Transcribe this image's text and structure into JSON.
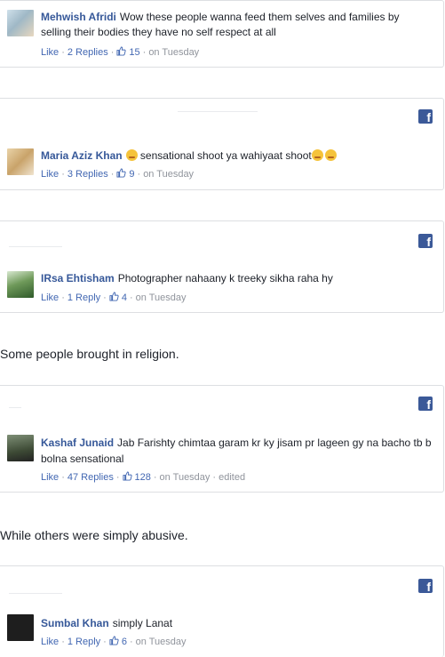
{
  "comments": [
    {
      "author": "Mehwish Afridi",
      "text": "Wow these people wanna feed them selves and families by selling their bodies they have no self respect at all",
      "like_label": "Like",
      "replies_label": "2 Replies",
      "likes": "15",
      "time": "on Tuesday"
    },
    {
      "author": "Maria Aziz Khan",
      "text_before": "sensational shoot ya wahiyaat shoot",
      "like_label": "Like",
      "replies_label": "3 Replies",
      "likes": "9",
      "time": "on Tuesday"
    },
    {
      "author": "IRsa Ehtisham",
      "text": "Photographer nahaany k treeky sikha raha hy",
      "like_label": "Like",
      "replies_label": "1 Reply",
      "likes": "4",
      "time": "on Tuesday"
    },
    {
      "author": "Kashaf Junaid",
      "text": "Jab Farishty chimtaa garam kr ky jisam pr lageen gy na bacho tb b bolna sensational",
      "like_label": "Like",
      "replies_label": "47 Replies",
      "likes": "128",
      "time": "on Tuesday",
      "edited": "edited"
    },
    {
      "author": "Sumbal Khan",
      "text": "simply Lanat",
      "like_label": "Like",
      "replies_label": "1 Reply",
      "likes": "6",
      "time": "on Tuesday"
    }
  ],
  "paragraphs": {
    "religion": "Some people brought in religion.",
    "abusive": "While others were simply abusive."
  },
  "icons": {
    "facebook": "facebook-icon",
    "like": "thumbs-up-icon",
    "emoji": "unamused-face-emoji"
  },
  "colors": {
    "author": "#365899",
    "link": "#4267b2",
    "meta": "#90949c",
    "facebook": "#3b5998"
  }
}
